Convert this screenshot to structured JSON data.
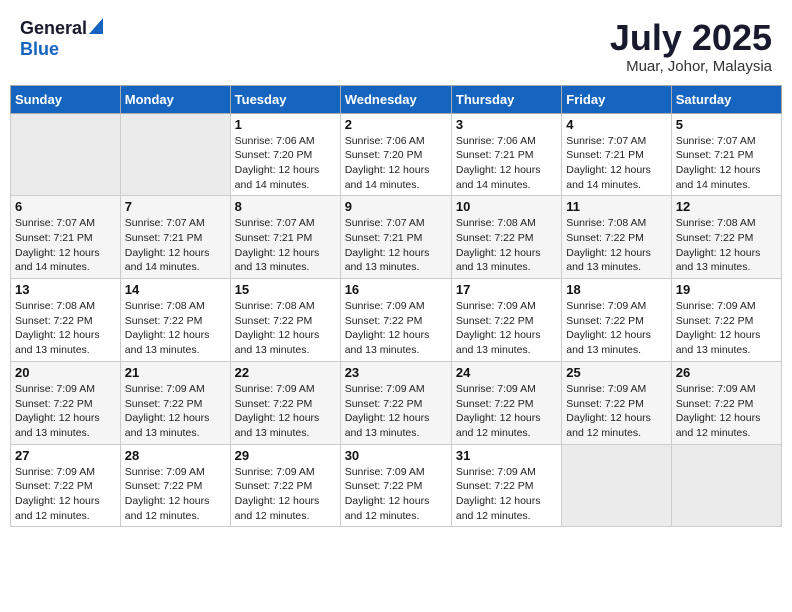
{
  "header": {
    "logo_general": "General",
    "logo_blue": "Blue",
    "month_title": "July 2025",
    "location": "Muar, Johor, Malaysia"
  },
  "weekdays": [
    "Sunday",
    "Monday",
    "Tuesday",
    "Wednesday",
    "Thursday",
    "Friday",
    "Saturday"
  ],
  "weeks": [
    [
      {
        "day": "",
        "sunrise": "",
        "sunset": "",
        "daylight": ""
      },
      {
        "day": "",
        "sunrise": "",
        "sunset": "",
        "daylight": ""
      },
      {
        "day": "1",
        "sunrise": "Sunrise: 7:06 AM",
        "sunset": "Sunset: 7:20 PM",
        "daylight": "Daylight: 12 hours and 14 minutes."
      },
      {
        "day": "2",
        "sunrise": "Sunrise: 7:06 AM",
        "sunset": "Sunset: 7:20 PM",
        "daylight": "Daylight: 12 hours and 14 minutes."
      },
      {
        "day": "3",
        "sunrise": "Sunrise: 7:06 AM",
        "sunset": "Sunset: 7:21 PM",
        "daylight": "Daylight: 12 hours and 14 minutes."
      },
      {
        "day": "4",
        "sunrise": "Sunrise: 7:07 AM",
        "sunset": "Sunset: 7:21 PM",
        "daylight": "Daylight: 12 hours and 14 minutes."
      },
      {
        "day": "5",
        "sunrise": "Sunrise: 7:07 AM",
        "sunset": "Sunset: 7:21 PM",
        "daylight": "Daylight: 12 hours and 14 minutes."
      }
    ],
    [
      {
        "day": "6",
        "sunrise": "Sunrise: 7:07 AM",
        "sunset": "Sunset: 7:21 PM",
        "daylight": "Daylight: 12 hours and 14 minutes."
      },
      {
        "day": "7",
        "sunrise": "Sunrise: 7:07 AM",
        "sunset": "Sunset: 7:21 PM",
        "daylight": "Daylight: 12 hours and 14 minutes."
      },
      {
        "day": "8",
        "sunrise": "Sunrise: 7:07 AM",
        "sunset": "Sunset: 7:21 PM",
        "daylight": "Daylight: 12 hours and 13 minutes."
      },
      {
        "day": "9",
        "sunrise": "Sunrise: 7:07 AM",
        "sunset": "Sunset: 7:21 PM",
        "daylight": "Daylight: 12 hours and 13 minutes."
      },
      {
        "day": "10",
        "sunrise": "Sunrise: 7:08 AM",
        "sunset": "Sunset: 7:22 PM",
        "daylight": "Daylight: 12 hours and 13 minutes."
      },
      {
        "day": "11",
        "sunrise": "Sunrise: 7:08 AM",
        "sunset": "Sunset: 7:22 PM",
        "daylight": "Daylight: 12 hours and 13 minutes."
      },
      {
        "day": "12",
        "sunrise": "Sunrise: 7:08 AM",
        "sunset": "Sunset: 7:22 PM",
        "daylight": "Daylight: 12 hours and 13 minutes."
      }
    ],
    [
      {
        "day": "13",
        "sunrise": "Sunrise: 7:08 AM",
        "sunset": "Sunset: 7:22 PM",
        "daylight": "Daylight: 12 hours and 13 minutes."
      },
      {
        "day": "14",
        "sunrise": "Sunrise: 7:08 AM",
        "sunset": "Sunset: 7:22 PM",
        "daylight": "Daylight: 12 hours and 13 minutes."
      },
      {
        "day": "15",
        "sunrise": "Sunrise: 7:08 AM",
        "sunset": "Sunset: 7:22 PM",
        "daylight": "Daylight: 12 hours and 13 minutes."
      },
      {
        "day": "16",
        "sunrise": "Sunrise: 7:09 AM",
        "sunset": "Sunset: 7:22 PM",
        "daylight": "Daylight: 12 hours and 13 minutes."
      },
      {
        "day": "17",
        "sunrise": "Sunrise: 7:09 AM",
        "sunset": "Sunset: 7:22 PM",
        "daylight": "Daylight: 12 hours and 13 minutes."
      },
      {
        "day": "18",
        "sunrise": "Sunrise: 7:09 AM",
        "sunset": "Sunset: 7:22 PM",
        "daylight": "Daylight: 12 hours and 13 minutes."
      },
      {
        "day": "19",
        "sunrise": "Sunrise: 7:09 AM",
        "sunset": "Sunset: 7:22 PM",
        "daylight": "Daylight: 12 hours and 13 minutes."
      }
    ],
    [
      {
        "day": "20",
        "sunrise": "Sunrise: 7:09 AM",
        "sunset": "Sunset: 7:22 PM",
        "daylight": "Daylight: 12 hours and 13 minutes."
      },
      {
        "day": "21",
        "sunrise": "Sunrise: 7:09 AM",
        "sunset": "Sunset: 7:22 PM",
        "daylight": "Daylight: 12 hours and 13 minutes."
      },
      {
        "day": "22",
        "sunrise": "Sunrise: 7:09 AM",
        "sunset": "Sunset: 7:22 PM",
        "daylight": "Daylight: 12 hours and 13 minutes."
      },
      {
        "day": "23",
        "sunrise": "Sunrise: 7:09 AM",
        "sunset": "Sunset: 7:22 PM",
        "daylight": "Daylight: 12 hours and 13 minutes."
      },
      {
        "day": "24",
        "sunrise": "Sunrise: 7:09 AM",
        "sunset": "Sunset: 7:22 PM",
        "daylight": "Daylight: 12 hours and 12 minutes."
      },
      {
        "day": "25",
        "sunrise": "Sunrise: 7:09 AM",
        "sunset": "Sunset: 7:22 PM",
        "daylight": "Daylight: 12 hours and 12 minutes."
      },
      {
        "day": "26",
        "sunrise": "Sunrise: 7:09 AM",
        "sunset": "Sunset: 7:22 PM",
        "daylight": "Daylight: 12 hours and 12 minutes."
      }
    ],
    [
      {
        "day": "27",
        "sunrise": "Sunrise: 7:09 AM",
        "sunset": "Sunset: 7:22 PM",
        "daylight": "Daylight: 12 hours and 12 minutes."
      },
      {
        "day": "28",
        "sunrise": "Sunrise: 7:09 AM",
        "sunset": "Sunset: 7:22 PM",
        "daylight": "Daylight: 12 hours and 12 minutes."
      },
      {
        "day": "29",
        "sunrise": "Sunrise: 7:09 AM",
        "sunset": "Sunset: 7:22 PM",
        "daylight": "Daylight: 12 hours and 12 minutes."
      },
      {
        "day": "30",
        "sunrise": "Sunrise: 7:09 AM",
        "sunset": "Sunset: 7:22 PM",
        "daylight": "Daylight: 12 hours and 12 minutes."
      },
      {
        "day": "31",
        "sunrise": "Sunrise: 7:09 AM",
        "sunset": "Sunset: 7:22 PM",
        "daylight": "Daylight: 12 hours and 12 minutes."
      },
      {
        "day": "",
        "sunrise": "",
        "sunset": "",
        "daylight": ""
      },
      {
        "day": "",
        "sunrise": "",
        "sunset": "",
        "daylight": ""
      }
    ]
  ]
}
